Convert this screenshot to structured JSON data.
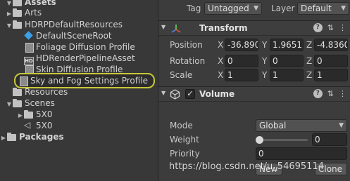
{
  "project": {
    "items": [
      {
        "label": "Assets",
        "icon": "folder-icon",
        "expanded": true
      },
      {
        "label": "Arts",
        "icon": "folder-icon"
      },
      {
        "label": "HDRPDefaultResources",
        "icon": "folder-icon",
        "expanded": true
      },
      {
        "label": "DefaultSceneRoot",
        "icon": "prefab-cube-icon"
      },
      {
        "label": "Foliage Diffusion Profile",
        "icon": "asset-icon"
      },
      {
        "label": "HDRenderPipelineAsset",
        "icon": "hd-asset-icon"
      },
      {
        "label": "Skin Diffusion Profile",
        "icon": "asset-icon"
      },
      {
        "label": "Sky and Fog Settings Profile",
        "icon": "asset-icon",
        "selected": true
      },
      {
        "label": "Resources",
        "icon": "folder-icon"
      },
      {
        "label": "Scenes",
        "icon": "folder-icon",
        "expanded": true
      },
      {
        "label": "5X0",
        "icon": "folder-icon"
      },
      {
        "label": "5X0",
        "icon": "scene-icon"
      },
      {
        "label": "Packages",
        "icon": "folder-icon"
      }
    ]
  },
  "inspector": {
    "tag_label": "Tag",
    "tag_value": "Untagged",
    "layer_label": "Layer",
    "layer_value": "Default",
    "transform": {
      "title": "Transform",
      "position_label": "Position",
      "rotation_label": "Rotation",
      "scale_label": "Scale",
      "axis_x": "X",
      "axis_y": "Y",
      "axis_z": "Z",
      "position": {
        "x": "-36.890",
        "y": "1.96517",
        "z": "-4.8360"
      },
      "rotation": {
        "x": "0",
        "y": "0",
        "z": "0"
      },
      "scale": {
        "x": "1",
        "y": "1",
        "z": "1"
      }
    },
    "volume": {
      "title": "Volume",
      "enabled": "✓",
      "mode_label": "Mode",
      "mode_value": "Global",
      "weight_label": "Weight",
      "weight_value": "0",
      "weight_fraction": 0,
      "priority_label": "Priority",
      "priority_value": "0",
      "profile_new_label": "New",
      "profile_clone_label": "Clone"
    }
  },
  "watermark": "https://blog.csdn.net/u_54695114",
  "colors": {
    "selection_outline": "#c8c83a",
    "prefab_blue": "#3aa0e8"
  }
}
